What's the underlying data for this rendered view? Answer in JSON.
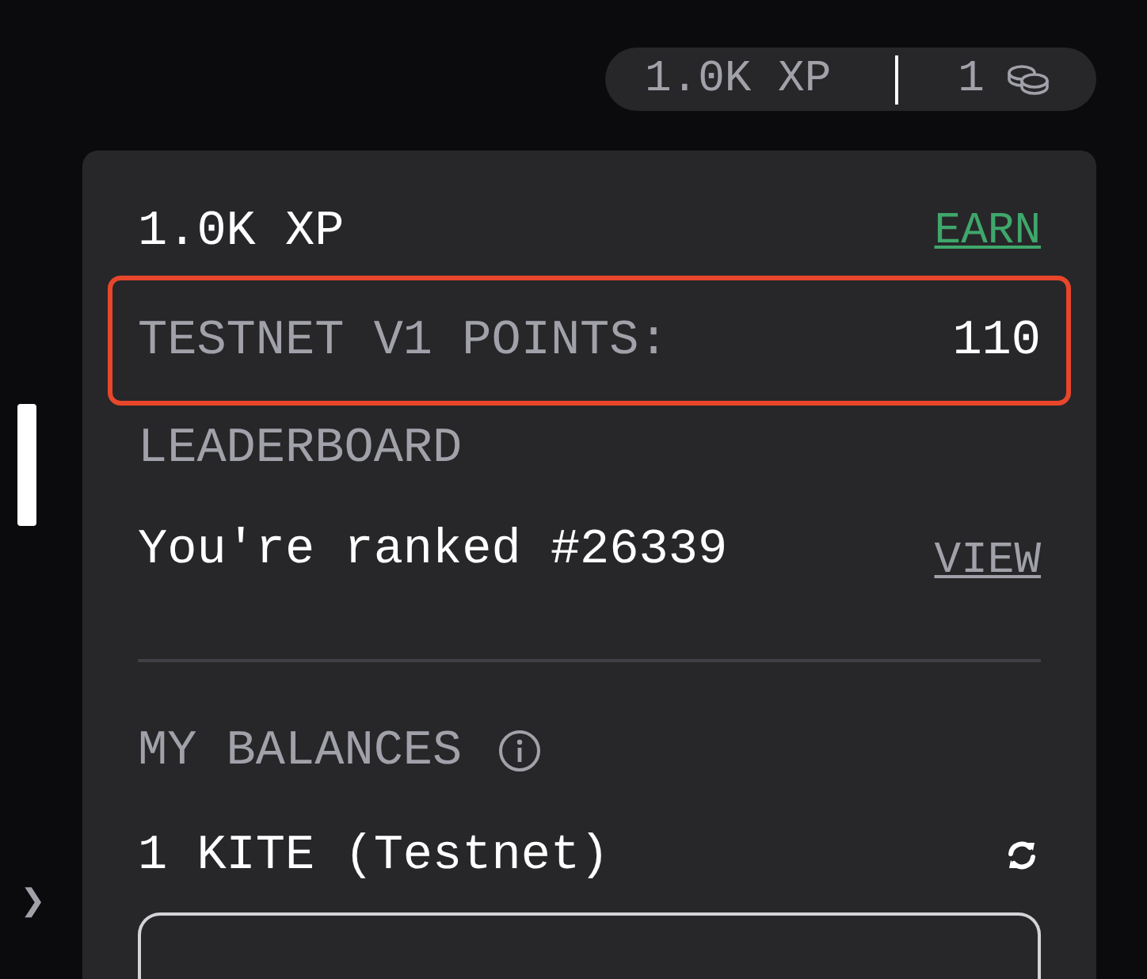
{
  "header": {
    "xp": "1.0K XP",
    "coins": "1"
  },
  "card": {
    "xp": "1.0K XP",
    "earn_link": "EARN",
    "testnet_points": {
      "label": "TESTNET V1 POINTS:",
      "value": "110",
      "highlighted": true
    },
    "leaderboard": {
      "title": "LEADERBOARD",
      "rank_text": "You're ranked #26339",
      "view_link": "VIEW"
    },
    "balances": {
      "title": "MY BALANCES",
      "items": [
        {
          "text": "1 KITE (Testnet)"
        }
      ]
    }
  },
  "side_toggle": "❯"
}
